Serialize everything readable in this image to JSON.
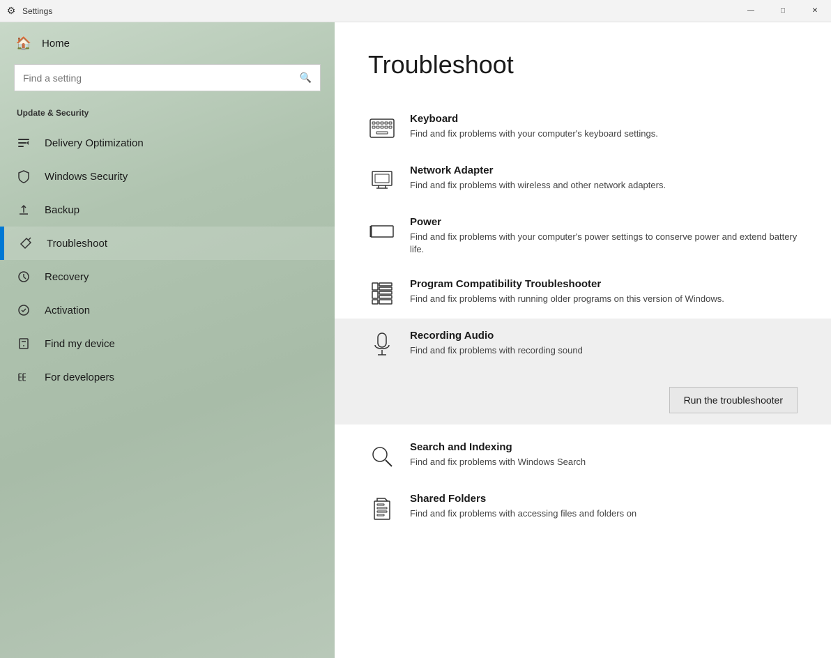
{
  "titlebar": {
    "title": "Settings",
    "minimize_label": "—",
    "maximize_label": "□",
    "close_label": "✕"
  },
  "sidebar": {
    "home_label": "Home",
    "search_placeholder": "Find a setting",
    "section_title": "Update & Security",
    "nav_items": [
      {
        "id": "delivery-optimization",
        "label": "Delivery Optimization",
        "icon": "delivery"
      },
      {
        "id": "windows-security",
        "label": "Windows Security",
        "icon": "shield"
      },
      {
        "id": "backup",
        "label": "Backup",
        "icon": "backup"
      },
      {
        "id": "troubleshoot",
        "label": "Troubleshoot",
        "icon": "troubleshoot",
        "active": true
      },
      {
        "id": "recovery",
        "label": "Recovery",
        "icon": "recovery"
      },
      {
        "id": "activation",
        "label": "Activation",
        "icon": "activation"
      },
      {
        "id": "find-my-device",
        "label": "Find my device",
        "icon": "find"
      },
      {
        "id": "for-developers",
        "label": "For developers",
        "icon": "developers"
      }
    ]
  },
  "content": {
    "page_title": "Troubleshoot",
    "items": [
      {
        "id": "keyboard",
        "name": "Keyboard",
        "desc": "Find and fix problems with your computer's keyboard settings.",
        "icon": "keyboard",
        "expanded": false
      },
      {
        "id": "network-adapter",
        "name": "Network Adapter",
        "desc": "Find and fix problems with wireless and other network adapters.",
        "icon": "network",
        "expanded": false
      },
      {
        "id": "power",
        "name": "Power",
        "desc": "Find and fix problems with your computer's power settings to conserve power and extend battery life.",
        "icon": "power",
        "expanded": false
      },
      {
        "id": "program-compatibility",
        "name": "Program Compatibility Troubleshooter",
        "desc": "Find and fix problems with running older programs on this version of Windows.",
        "icon": "compatibility",
        "expanded": false
      },
      {
        "id": "recording-audio",
        "name": "Recording Audio",
        "desc": "Find and fix problems with recording sound",
        "icon": "microphone",
        "expanded": true
      },
      {
        "id": "search-indexing",
        "name": "Search and Indexing",
        "desc": "Find and fix problems with Windows Search",
        "icon": "search",
        "expanded": false
      },
      {
        "id": "shared-folders",
        "name": "Shared Folders",
        "desc": "Find and fix problems with accessing files and folders on",
        "icon": "shared",
        "expanded": false
      }
    ],
    "run_button_label": "Run the troubleshooter"
  }
}
